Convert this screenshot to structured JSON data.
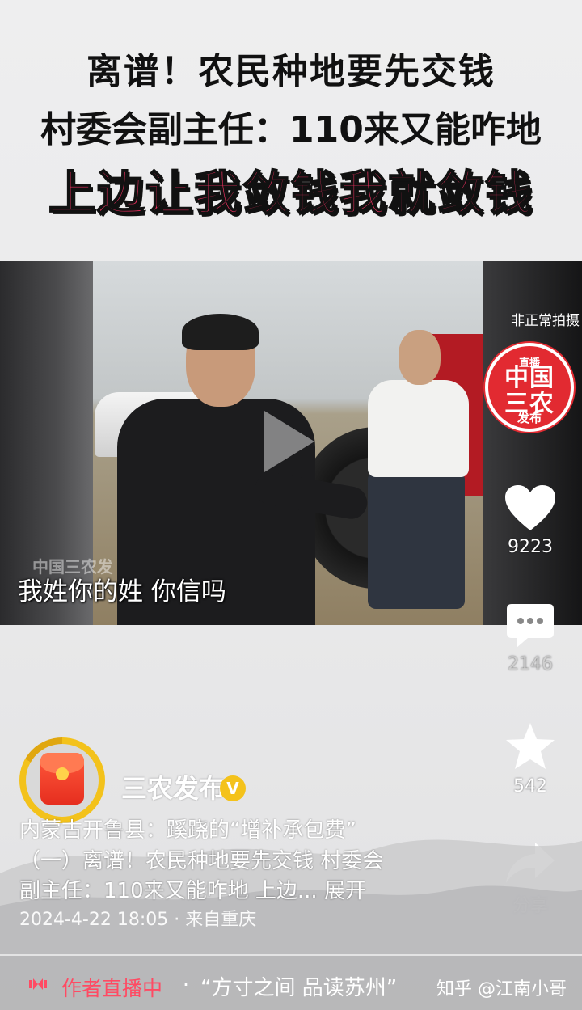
{
  "headline": {
    "line1": "离谱！农民种地要先交钱",
    "line2": "村委会副主任：110来又能咋地",
    "line3": "上边让我敛钱我就敛钱"
  },
  "video": {
    "subtitle": "我姓你的姓  你信吗",
    "watermark": "中国三农发"
  },
  "channel": {
    "tag": "非正常拍摄",
    "logo_top": "直播",
    "logo_mid": "中国\n三农",
    "logo_bottom": "发布"
  },
  "actions": {
    "like_count": "9223",
    "comment_count": "2146",
    "favorite_count": "542",
    "share_label": "分享"
  },
  "author": {
    "name": "三农发布",
    "verified_mark": "V"
  },
  "description": {
    "line1": "内蒙古开鲁县：蹊跷的“增补承包费”",
    "line2": "（一）离谱！农民种地要先交钱 村委会",
    "line3": "副主任：110来又能咋地 上边...",
    "expand": "展开",
    "meta": "2024-4-22 18:05 · 来自重庆"
  },
  "bottom_bar": {
    "live_text": "作者直播中",
    "separator": "·",
    "live_title": "“方寸之间 品读苏州”",
    "source": "知乎 @江南小哥"
  },
  "colors": {
    "accent_red": "#e8305e",
    "live_red": "#ff4a63",
    "verified_gold": "#f4c21b",
    "logo_red": "#e22a31"
  }
}
